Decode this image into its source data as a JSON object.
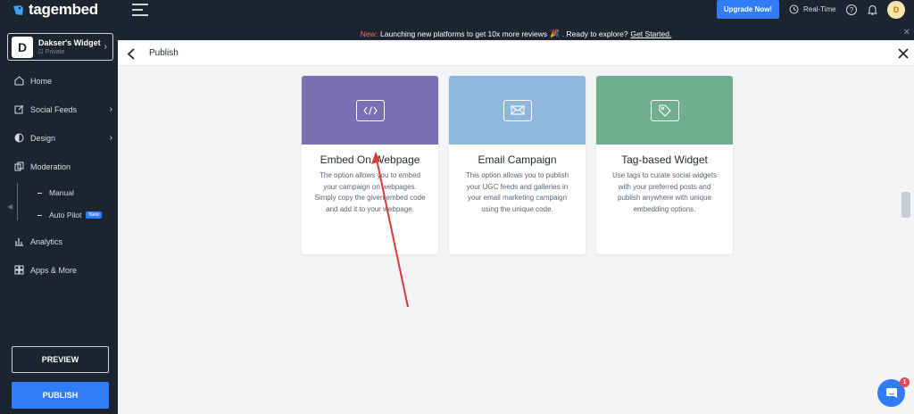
{
  "brand": {
    "name": "tagembed"
  },
  "widget": {
    "avatar_letter": "D",
    "name": "Dakser's Widget",
    "status": "Private"
  },
  "nav": {
    "home": "Home",
    "social_feeds": "Social Feeds",
    "design": "Design",
    "moderation": "Moderation",
    "manual": "Manual",
    "auto_pilot": "Auto Pilot",
    "new_badge": "New",
    "analytics": "Analytics",
    "apps_more": "Apps & More"
  },
  "sidebar_buttons": {
    "preview": "PREVIEW",
    "publish": "PUBLISH"
  },
  "topbar": {
    "upgrade": "Upgrade Now!",
    "realtime": "Real-Time",
    "help": "?",
    "user_initial": "D"
  },
  "announcement": {
    "new_label": "New:",
    "message": "Launching new platforms to get 10x more reviews",
    "emoji": "🎉",
    "question": ". Ready to explore?",
    "cta": "Get Started."
  },
  "publish_header": {
    "title": "Publish"
  },
  "cards": [
    {
      "title": "Embed On Webpage",
      "description": "The option allows you to embed your campaign on webpages. Simply copy the given embed code and add it to your webpage.",
      "color": "#7b6fb3",
      "icon": "code-icon"
    },
    {
      "title": "Email Campaign",
      "description": "This option allows you to publish your UGC feeds and galleries in your email marketing campaign using the unique code.",
      "color": "#8fb8dc",
      "icon": "mail-icon"
    },
    {
      "title": "Tag-based Widget",
      "description": "Use tags to curate social widgets with your preferred posts and publish anywhere with unique embedding options.",
      "color": "#6fae8e",
      "icon": "tag-icon"
    }
  ],
  "chat": {
    "badge_count": "1"
  },
  "colors": {
    "sidebar_bg": "#1b2530",
    "accent": "#2f7cf6",
    "annotation": "#d93a3a"
  }
}
